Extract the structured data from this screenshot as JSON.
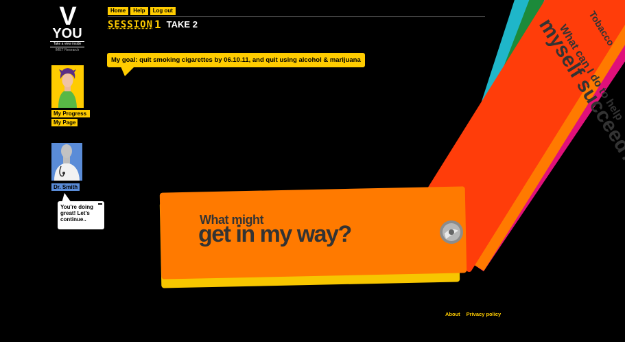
{
  "logo": {
    "letter": "V",
    "word": "YOU",
    "tagline": "Take a view inside",
    "sub": "IMET Research"
  },
  "nav": {
    "home": "Home",
    "help": "Help",
    "logout": "Log out"
  },
  "session": {
    "label": "SESSION",
    "number": "1",
    "take": "TAKE 2"
  },
  "goal": {
    "text": "My goal: quit smoking cigarettes by 06.10.11, and quit using alcohol & marijuana"
  },
  "sidebar": {
    "my_progress": "My Progress",
    "my_page": "My Page",
    "doctor_name": "Dr. Smith",
    "speech": "You're doing great! Let's continue.."
  },
  "cards": {
    "main_line1": "What might",
    "main_line2": "get in my way?",
    "red_line1": "What can I do to help",
    "red_line2": "myself succeed?",
    "orange_tab": "Tobacco"
  },
  "footer": {
    "about": "About",
    "privacy": "Privacy policy"
  },
  "colors": {
    "accent": "#ffcc00",
    "orange": "#ff7a00",
    "red": "#ff3d0a",
    "doctor_blue": "#5a8cd8"
  }
}
